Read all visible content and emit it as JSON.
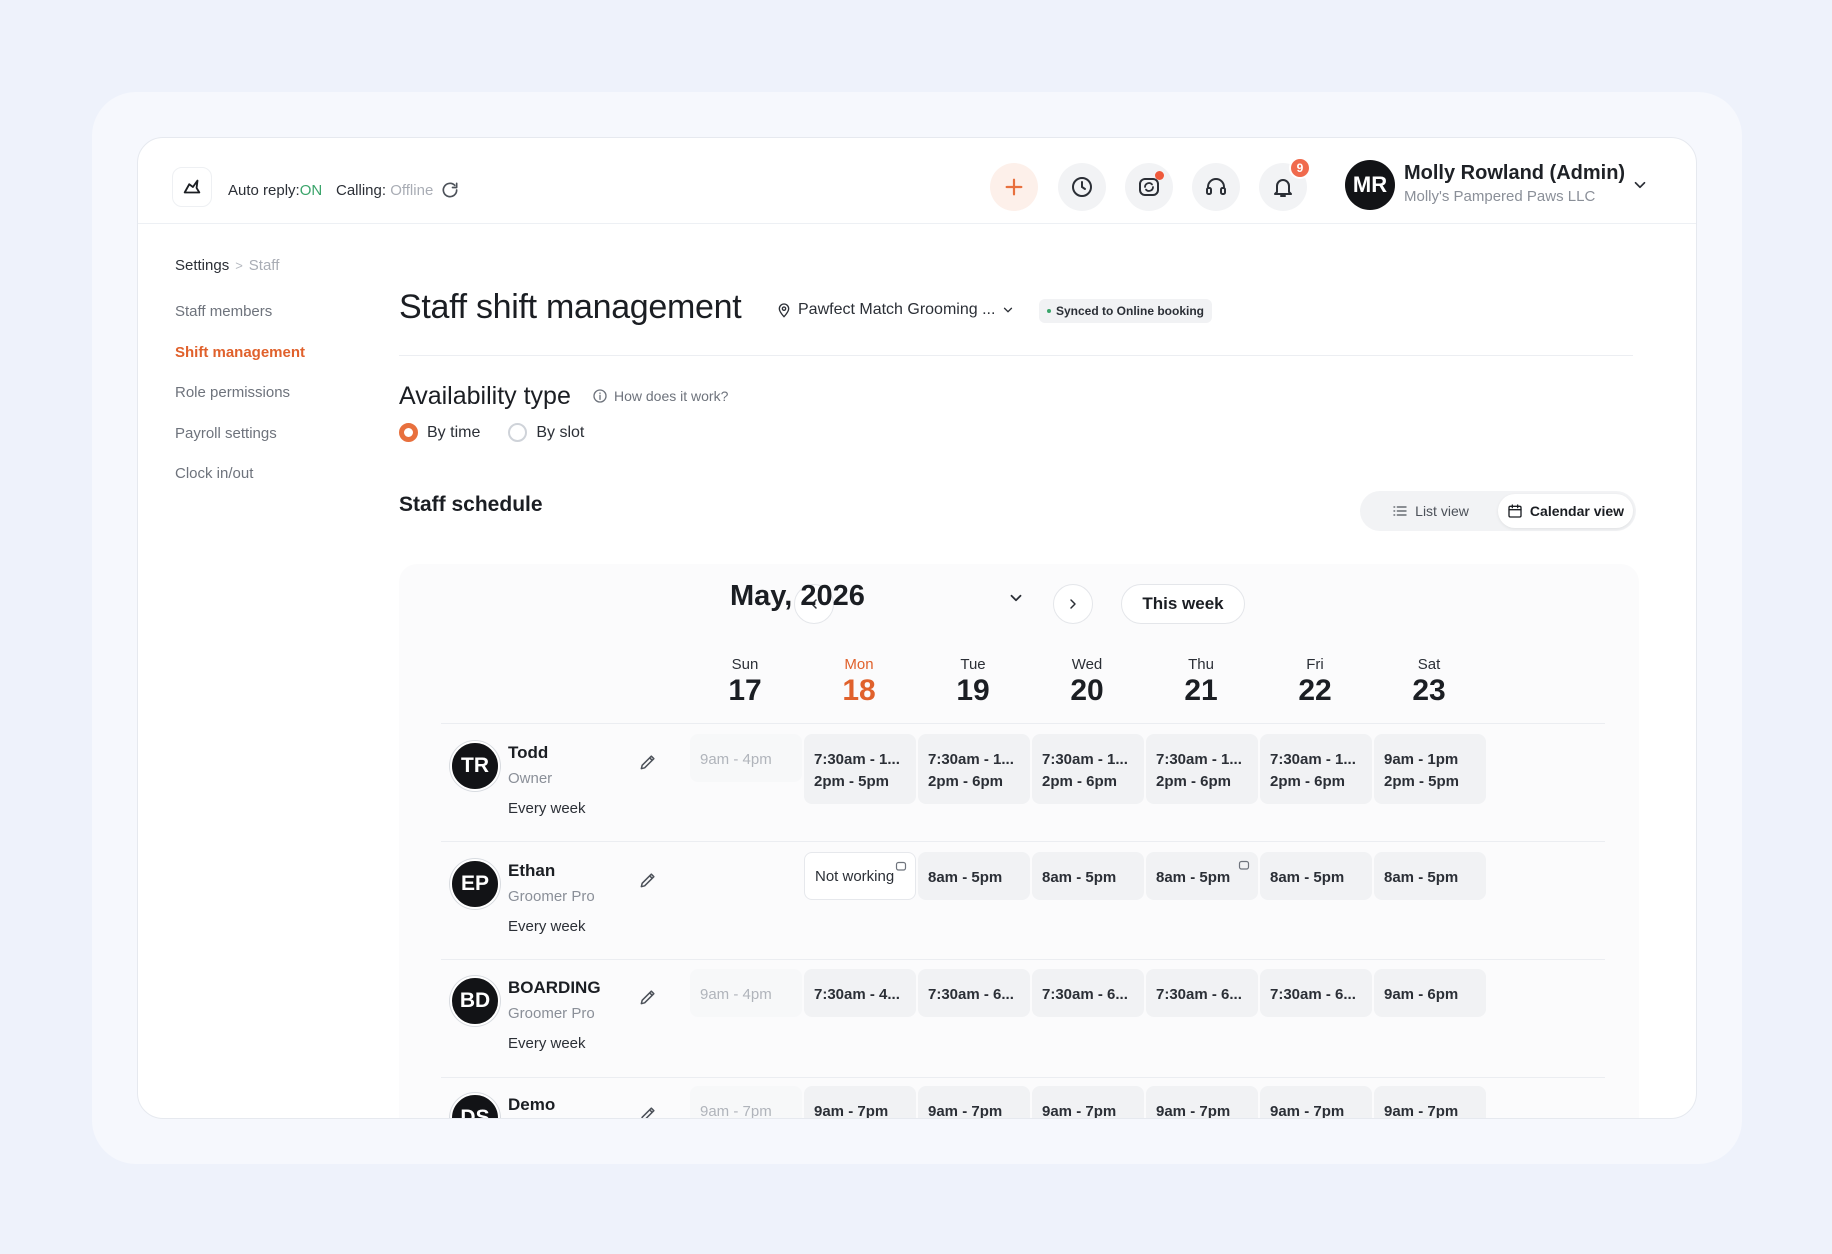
{
  "topbar": {
    "auto_reply_label": "Auto reply:",
    "auto_reply_value": "ON",
    "calling_label": "Calling:",
    "calling_value": "Offline",
    "notification_count": "9",
    "user_initials": "MR",
    "user_name": "Molly Rowland (Admin)",
    "user_business": "Molly's Pampered Paws LLC"
  },
  "breadcrumb": {
    "root": "Settings",
    "current": "Staff"
  },
  "sidebar": {
    "items": [
      {
        "label": "Staff members"
      },
      {
        "label": "Shift management"
      },
      {
        "label": "Role permissions"
      },
      {
        "label": "Payroll settings"
      },
      {
        "label": "Clock in/out"
      }
    ]
  },
  "main": {
    "title": "Staff shift management",
    "location": "Pawfect Match Grooming ...",
    "synced_badge": "Synced to Online booking",
    "availability_title": "Availability type",
    "how_link": "How does it work?",
    "radio_by_time": "By time",
    "radio_by_slot": "By slot",
    "schedule_title": "Staff schedule",
    "list_view": "List view",
    "calendar_view": "Calendar view"
  },
  "calendar": {
    "month": "May, 2026",
    "this_week": "This week",
    "days": [
      {
        "name": "Sun",
        "num": "17"
      },
      {
        "name": "Mon",
        "num": "18"
      },
      {
        "name": "Tue",
        "num": "19"
      },
      {
        "name": "Wed",
        "num": "20"
      },
      {
        "name": "Thu",
        "num": "21"
      },
      {
        "name": "Fri",
        "num": "22"
      },
      {
        "name": "Sat",
        "num": "23"
      }
    ],
    "staff": [
      {
        "initials": "TR",
        "name": "Todd",
        "role": "Owner",
        "repeat": "Every week",
        "shifts": [
          {
            "l1": "9am - 4pm",
            "l2": ""
          },
          {
            "l1": "7:30am - 1...",
            "l2": "2pm - 5pm"
          },
          {
            "l1": "7:30am - 1...",
            "l2": "2pm - 6pm"
          },
          {
            "l1": "7:30am - 1...",
            "l2": "2pm - 6pm"
          },
          {
            "l1": "7:30am - 1...",
            "l2": "2pm - 6pm"
          },
          {
            "l1": "7:30am - 1...",
            "l2": "2pm - 6pm"
          },
          {
            "l1": "9am - 1pm",
            "l2": "2pm - 5pm"
          }
        ]
      },
      {
        "initials": "EP",
        "name": "Ethan",
        "role": "Groomer Pro",
        "repeat": "Every week",
        "shifts": [
          {
            "l1": "",
            "l2": ""
          },
          {
            "l1": "Not working",
            "l2": ""
          },
          {
            "l1": "8am - 5pm",
            "l2": ""
          },
          {
            "l1": "8am - 5pm",
            "l2": ""
          },
          {
            "l1": "8am - 5pm",
            "l2": ""
          },
          {
            "l1": "8am - 5pm",
            "l2": ""
          },
          {
            "l1": "8am - 5pm",
            "l2": ""
          }
        ]
      },
      {
        "initials": "BD",
        "name": "BOARDING",
        "role": "Groomer Pro",
        "repeat": "Every week",
        "shifts": [
          {
            "l1": "9am - 4pm",
            "l2": ""
          },
          {
            "l1": "7:30am - 4...",
            "l2": ""
          },
          {
            "l1": "7:30am - 6...",
            "l2": ""
          },
          {
            "l1": "7:30am - 6...",
            "l2": ""
          },
          {
            "l1": "7:30am - 6...",
            "l2": ""
          },
          {
            "l1": "7:30am - 6...",
            "l2": ""
          },
          {
            "l1": "9am - 6pm",
            "l2": ""
          }
        ]
      },
      {
        "initials": "DS",
        "name": "Demo",
        "role": "",
        "repeat": "",
        "shifts": [
          {
            "l1": "9am - 7pm",
            "l2": ""
          },
          {
            "l1": "9am - 7pm",
            "l2": ""
          },
          {
            "l1": "9am - 7pm",
            "l2": ""
          },
          {
            "l1": "9am - 7pm",
            "l2": ""
          },
          {
            "l1": "9am - 7pm",
            "l2": ""
          },
          {
            "l1": "9am - 7pm",
            "l2": ""
          },
          {
            "l1": "9am - 7pm",
            "l2": ""
          }
        ]
      }
    ]
  },
  "colors": {
    "accent": "#e0612c",
    "on_green": "#3aa46a",
    "avatar_bg": "#121316"
  }
}
